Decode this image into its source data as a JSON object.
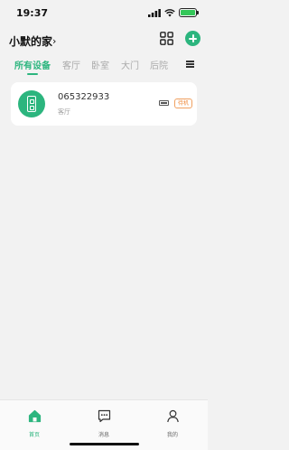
{
  "status_bar": {
    "time": "19:37",
    "icons": [
      "signal-icon",
      "wifi-icon",
      "battery-icon"
    ],
    "battery_level": 1.0
  },
  "header": {
    "home_name": "小默的家",
    "chevron": "›",
    "grid_icon": "grid-icon",
    "add_icon": "add-icon"
  },
  "tabs": {
    "items": [
      {
        "label": "所有设备",
        "active": true
      },
      {
        "label": "客厅",
        "active": false
      },
      {
        "label": "卧室",
        "active": false
      },
      {
        "label": "大门",
        "active": false
      },
      {
        "label": "后院",
        "active": false
      }
    ],
    "menu_icon": "menu-icon"
  },
  "devices": [
    {
      "name": "065322933",
      "room": "客厅",
      "status_badge": "待机",
      "icon": "smart-lock-icon",
      "battery_icon": "battery-icon"
    }
  ],
  "bottom_nav": {
    "items": [
      {
        "label": "首页",
        "icon": "home-icon",
        "active": true
      },
      {
        "label": "消息",
        "icon": "message-icon",
        "active": false
      },
      {
        "label": "我的",
        "icon": "user-icon",
        "active": false
      }
    ]
  },
  "colors": {
    "accent": "#2cb57e",
    "badge": "#f08a3c",
    "background": "#f2f2f2"
  }
}
